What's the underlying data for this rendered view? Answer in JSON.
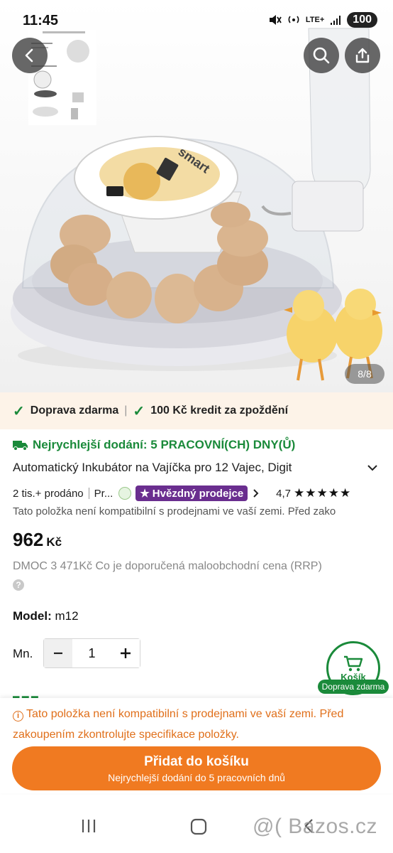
{
  "status_bar": {
    "time": "11:45",
    "network": "LTE+",
    "battery": "100"
  },
  "gallery": {
    "counter": "8/8",
    "icons": [
      "back-arrow-icon",
      "search-icon",
      "share-icon"
    ]
  },
  "benefits": {
    "item1": "Doprava zdarma",
    "item2": "100 Kč kredit za zpoždění"
  },
  "product": {
    "delivery": "Nejrychlejší dodání: 5 PRACOVNÍ(CH) DNY(Ů)",
    "title": "Automatický Inkubátor na Vajíčka pro 12 Vajec, Digit",
    "sold": "2 tis.+ prodáno",
    "seller_short": "Pr...",
    "star_seller": "Hvězdný prodejce",
    "rating": "4,7",
    "stars": "★★★★★",
    "compat_line": "Tato položka není kompatibilní s prodejnami ve vaší zemi. Před zako",
    "price_value": "962",
    "price_currency": "Kč",
    "rrp": "DMOC 3 471Kč Co je doporučená maloobchodní cena (RRP)",
    "model_label": "Model:",
    "model_value": "m12",
    "qty_label": "Mn.",
    "qty_value": "1"
  },
  "cart_fab": {
    "label": "Košík",
    "badge": "Doprava zdarma"
  },
  "bottom": {
    "warning": "Tato položka není kompatibilní s prodejnami ve vaší zemi. Před zakoupením zkontrolujte specifikace položky.",
    "add_button": "Přidat do košíku",
    "add_button_sub": "Nejrychlejší dodání do 5 pracovních dnů"
  },
  "watermark": "@( Bazos.cz",
  "colors": {
    "green": "#1a8a3a",
    "orange": "#f07a21",
    "warning_orange": "#e06f1a",
    "purple": "#6a2e8f",
    "benefits_bg": "#fdf3e8"
  }
}
